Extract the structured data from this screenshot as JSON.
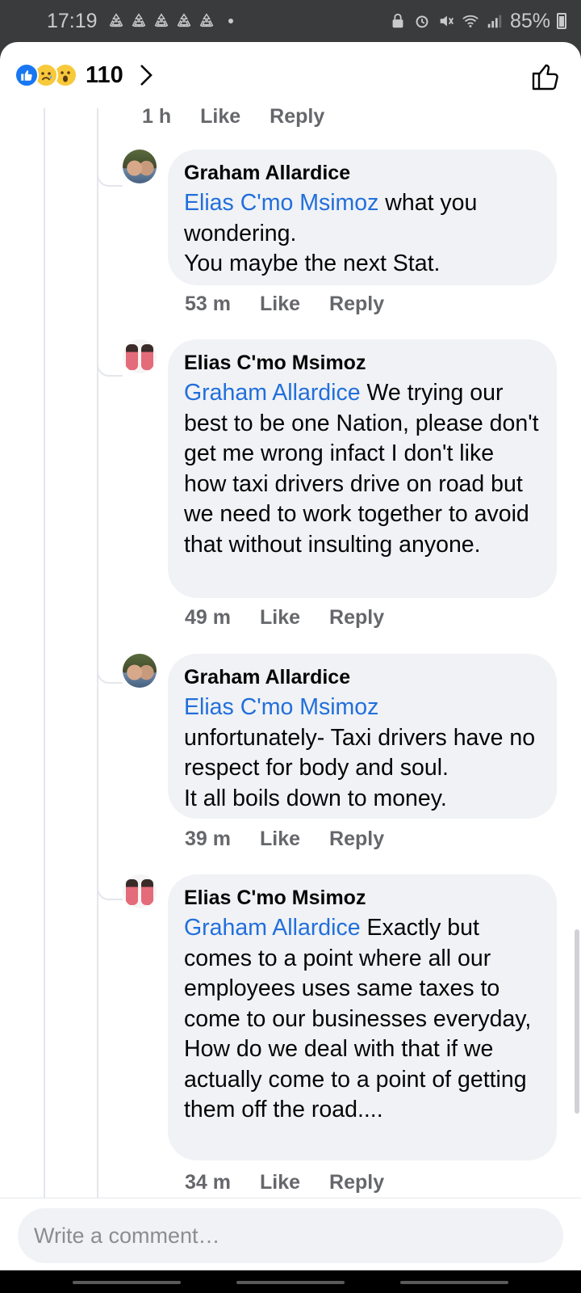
{
  "status_bar": {
    "time": "17:19",
    "battery": "85%"
  },
  "header": {
    "reaction_count": "110",
    "reactions": [
      "like",
      "sad",
      "wow"
    ]
  },
  "prev_meta": {
    "time": "1 h",
    "like": "Like",
    "reply": "Reply"
  },
  "comments": [
    {
      "author": "Graham Allardice",
      "mention": "Elias C'mo Msimoz",
      "text": " what you wondering.\nYou maybe the next Stat.",
      "time": "53 m",
      "like": "Like",
      "reply": "Reply"
    },
    {
      "author": "Elias C'mo Msimoz",
      "mention": "Graham Allardice",
      "text": " We trying our best to be one Nation, please don't get me wrong infact I don't like how taxi drivers drive on road but we need to work together to avoid that without insulting anyone.",
      "time": "49 m",
      "like": "Like",
      "reply": "Reply"
    },
    {
      "author": "Graham Allardice",
      "mention": "Elias C'mo Msimoz",
      "text": "unfortunately- Taxi drivers have no respect for body and soul.\nIt all boils down to money.",
      "time": "39 m",
      "like": "Like",
      "reply": "Reply"
    },
    {
      "author": "Elias C'mo Msimoz",
      "mention": "Graham Allardice",
      "text": " Exactly but comes to a point where all our employees uses same taxes to come to our businesses everyday, How do we deal with that if we actually come to a point of getting them off the road....",
      "time": "34 m",
      "like": "Like",
      "reply": "Reply"
    }
  ],
  "composer": {
    "placeholder": "Write a comment…"
  },
  "colors": {
    "link": "#216fdb",
    "bubble": "#f0f2f5",
    "meta": "#65676b",
    "like_blue": "#1877f2"
  }
}
